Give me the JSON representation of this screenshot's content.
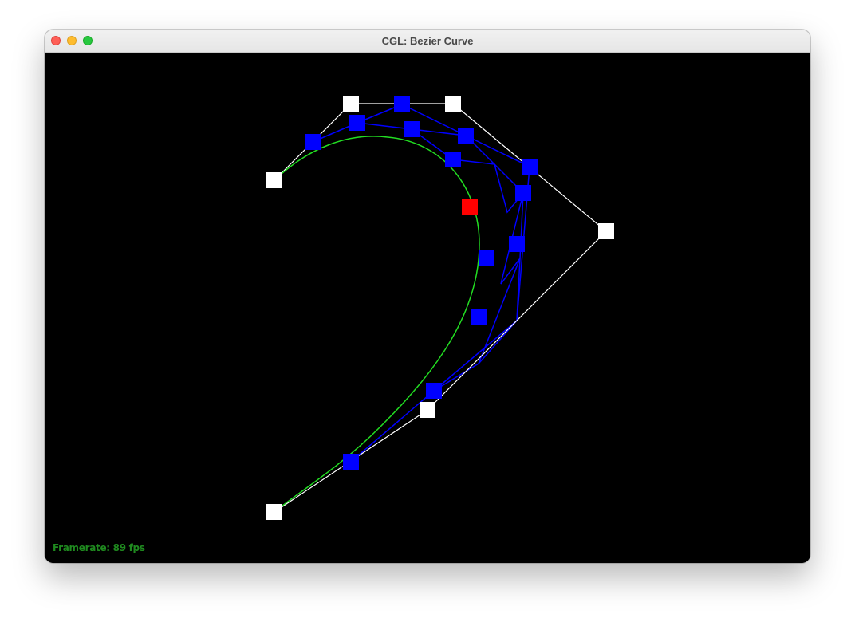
{
  "window": {
    "title": "CGL: Bezier Curve"
  },
  "status": {
    "framerate_text": "Framerate: 89 fps"
  },
  "colors": {
    "control_point": "#ffffff",
    "control_polygon": "#ffffff",
    "intermediate_point": "#0000ff",
    "intermediate_line": "#0000ff",
    "evaluated_point": "#ff0000",
    "curve": "#22dd22",
    "framerate": "#1f8a1f"
  }
}
